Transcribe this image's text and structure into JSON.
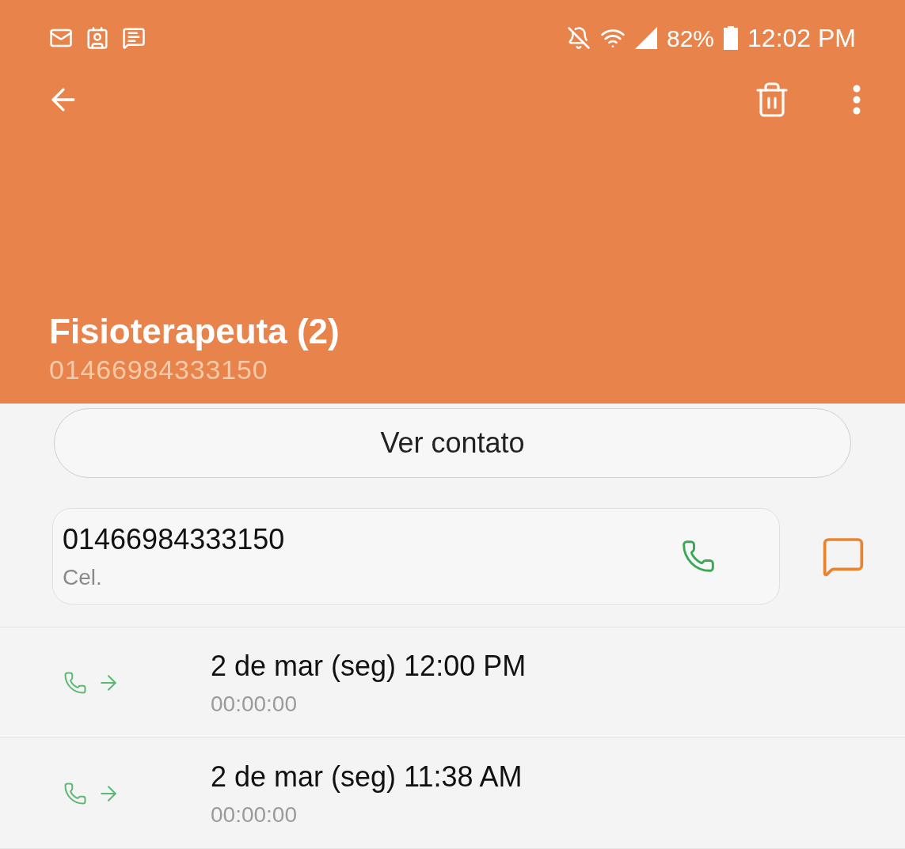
{
  "status_bar": {
    "battery_text": "82%",
    "time": "12:02 PM"
  },
  "contact": {
    "name": "Fisioterapeuta (2)",
    "number": "01466984333150"
  },
  "view_contact_button": "Ver contato",
  "number_card": {
    "number": "01466984333150",
    "type": "Cel."
  },
  "call_log": [
    {
      "datetime": "2 de mar (seg) 12:00 PM",
      "duration": "00:00:00"
    },
    {
      "datetime": "2 de mar (seg) 11:38 AM",
      "duration": "00:00:00"
    }
  ]
}
